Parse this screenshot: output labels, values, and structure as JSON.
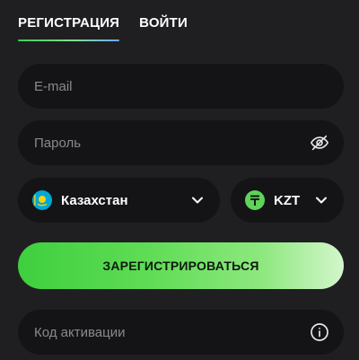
{
  "tabs": [
    {
      "label": "РЕГИСТРАЦИЯ",
      "active": true
    },
    {
      "label": "ВОЙТИ",
      "active": false
    }
  ],
  "form": {
    "email": {
      "placeholder": "E-mail",
      "value": ""
    },
    "password": {
      "placeholder": "Пароль",
      "value": "",
      "toggle_icon": "eye-off-icon"
    },
    "country": {
      "value": "Казахстан",
      "icon": "kazakhstan-flag-icon"
    },
    "currency": {
      "value": "KZT",
      "icon": "tenge-icon"
    },
    "submit_label": "ЗАРЕГИСТРИРОВАТЬСЯ",
    "activation_code": {
      "placeholder": "Код активации",
      "value": "",
      "info_icon": "info-icon"
    }
  },
  "colors": {
    "background": "#1f1f21",
    "field_background": "#141416",
    "accent_green": "#3fcf3e",
    "placeholder": "#8a8a8e"
  }
}
